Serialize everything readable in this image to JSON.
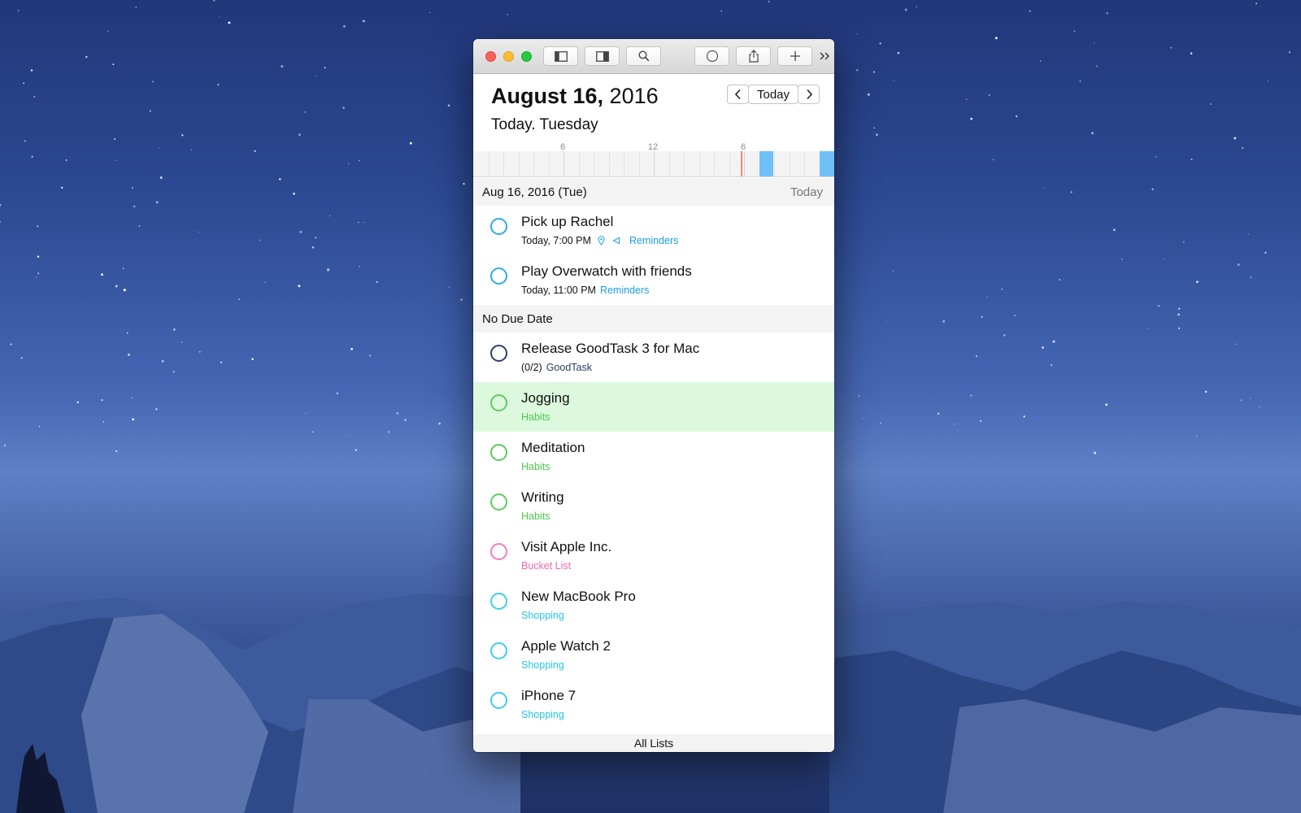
{
  "window": {
    "toolbar": {
      "icons": [
        "sidebar-left-icon",
        "sidebar-right-icon",
        "search-icon",
        "circle-icon",
        "share-icon",
        "plus-icon",
        "more-chevron-icon"
      ]
    },
    "header": {
      "date_bold": "August 16,",
      "date_year": "2016",
      "subtitle": "Today. Tuesday",
      "nav": {
        "prev_icon": "chevron-left-icon",
        "today_label": "Today",
        "next_icon": "chevron-right-icon"
      }
    },
    "timeline": {
      "tick_labels": [
        "6",
        "12",
        "6"
      ]
    },
    "sections": [
      {
        "label": "Aug 16, 2016 (Tue)",
        "right_label": "Today",
        "tasks": [
          {
            "title": "Pick up Rachel",
            "time": "Today, 7:00 PM",
            "list": "Reminders",
            "list_color": "#1a9ee6",
            "circle_color": "#2fa9e8",
            "has_icons": true
          },
          {
            "title": "Play Overwatch with friends",
            "time": "Today, 11:00 PM",
            "list": "Reminders",
            "list_color": "#1a9ee6",
            "circle_color": "#2fa9e8",
            "has_icons": false
          }
        ]
      },
      {
        "label": "No Due Date",
        "right_label": "",
        "tasks": [
          {
            "title": "Release GoodTask 3 for Mac",
            "time": "(0/2)",
            "list": "GoodTask",
            "list_color": "#2b3e6b",
            "circle_color": "#2b3e6b",
            "has_icons": false
          },
          {
            "title": "Jogging",
            "time": "",
            "list": "Habits",
            "list_color": "#4cc94c",
            "circle_color": "#5ccc5c",
            "has_icons": false,
            "highlighted": true
          },
          {
            "title": "Meditation",
            "time": "",
            "list": "Habits",
            "list_color": "#4cc94c",
            "circle_color": "#5ccc5c",
            "has_icons": false
          },
          {
            "title": "Writing",
            "time": "",
            "list": "Habits",
            "list_color": "#4cc94c",
            "circle_color": "#5ccc5c",
            "has_icons": false
          },
          {
            "title": "Visit Apple Inc.",
            "time": "",
            "list": "Bucket List",
            "list_color": "#f067b4",
            "circle_color": "#f67ab9",
            "has_icons": false
          },
          {
            "title": "New MacBook Pro",
            "time": "",
            "list": "Shopping",
            "list_color": "#22c8e6",
            "circle_color": "#3ccfe9",
            "has_icons": false
          },
          {
            "title": "Apple Watch 2",
            "time": "",
            "list": "Shopping",
            "list_color": "#22c8e6",
            "circle_color": "#3ccfe9",
            "has_icons": false
          },
          {
            "title": "iPhone 7",
            "time": "",
            "list": "Shopping",
            "list_color": "#22c8e6",
            "circle_color": "#3ccfe9",
            "has_icons": false
          }
        ]
      }
    ],
    "footer": {
      "label": "All Lists"
    }
  }
}
